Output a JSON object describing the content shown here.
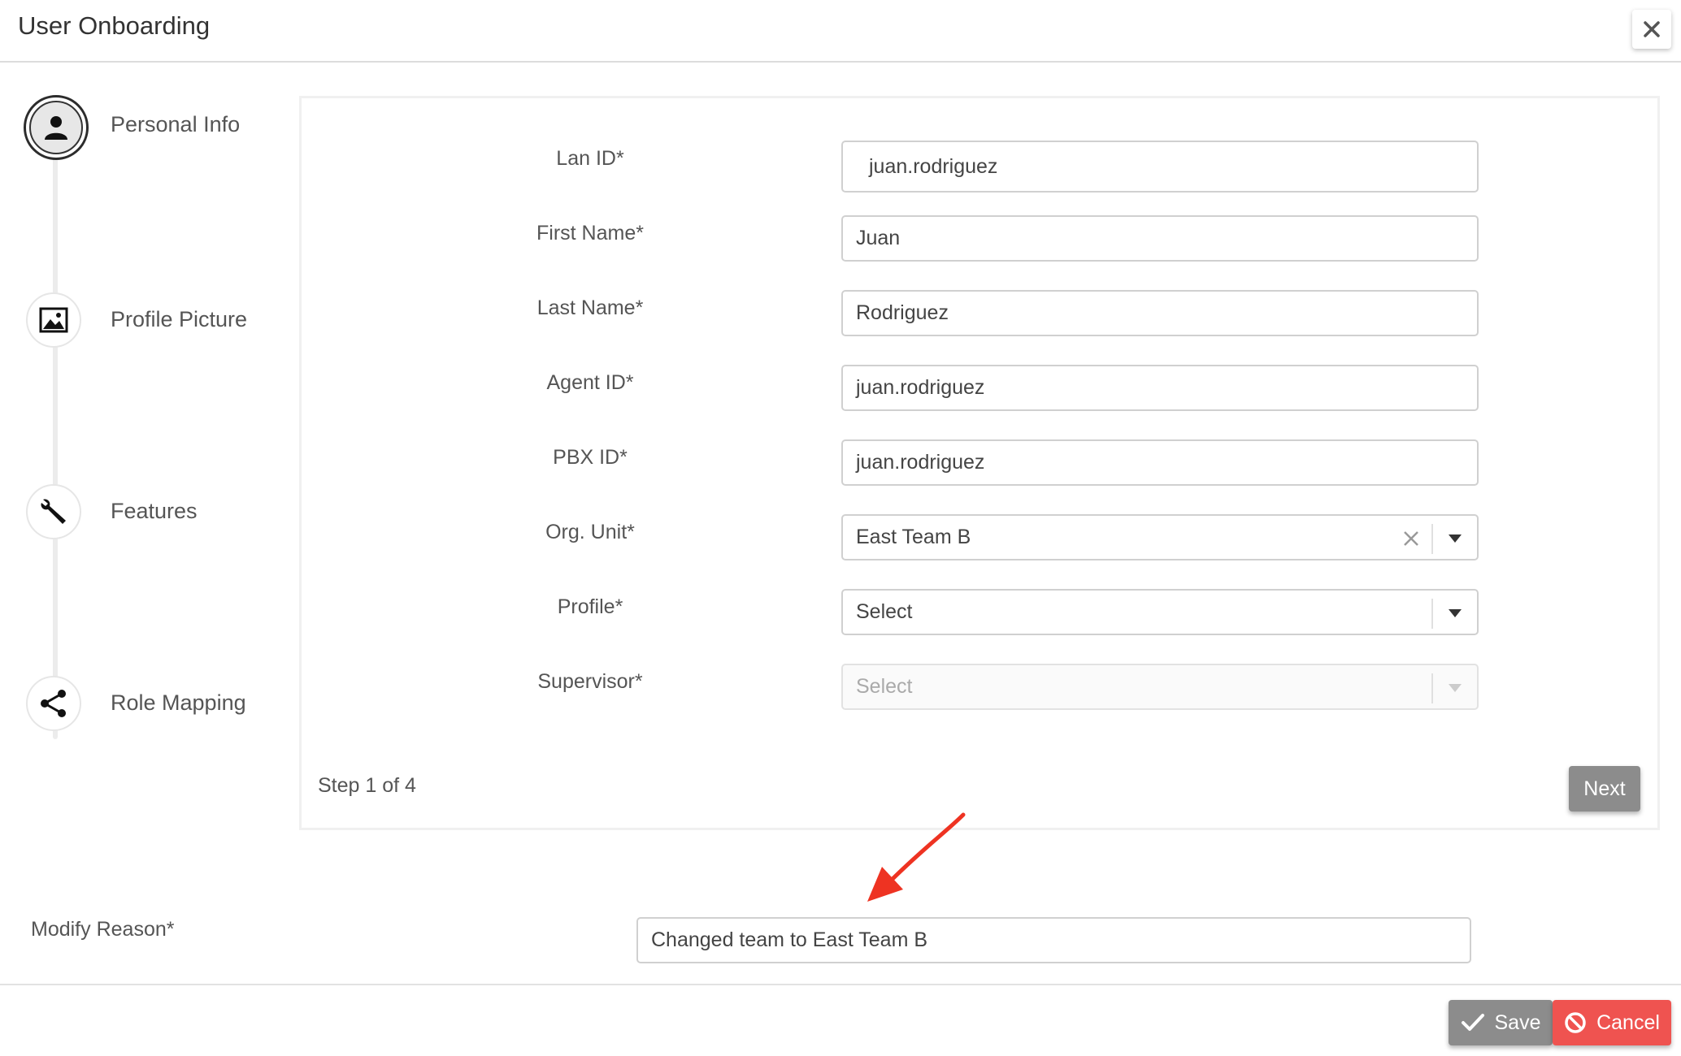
{
  "header": {
    "title": "User Onboarding",
    "close_icon": "close-icon"
  },
  "steps": [
    {
      "label": "Personal Info",
      "icon": "user-icon",
      "active": true
    },
    {
      "label": "Profile Picture",
      "icon": "image-icon",
      "active": false
    },
    {
      "label": "Features",
      "icon": "wrench-icon",
      "active": false
    },
    {
      "label": "Role Mapping",
      "icon": "share-icon",
      "active": false
    }
  ],
  "form": {
    "lan_id": {
      "label": "Lan ID*",
      "value": "juan.rodriguez"
    },
    "first_name": {
      "label": "First Name*",
      "value": "Juan"
    },
    "last_name": {
      "label": "Last Name*",
      "value": "Rodriguez"
    },
    "agent_id": {
      "label": "Agent ID*",
      "value": "juan.rodriguez"
    },
    "pbx_id": {
      "label": "PBX ID*",
      "value": "juan.rodriguez"
    },
    "org_unit": {
      "label": "Org. Unit*",
      "value": "East Team B"
    },
    "profile": {
      "label": "Profile*",
      "value": "Select"
    },
    "supervisor": {
      "label": "Supervisor*",
      "value": "Select"
    }
  },
  "footer_panel": {
    "step_text": "Step 1 of 4",
    "next_label": "Next"
  },
  "modify": {
    "label": "Modify Reason*",
    "value": "Changed team to East Team B"
  },
  "actions": {
    "save_label": "Save",
    "cancel_label": "Cancel"
  },
  "colors": {
    "cancel": "#ef5350",
    "save": "#8c8c8c",
    "annotation_arrow": "#ee3322"
  }
}
